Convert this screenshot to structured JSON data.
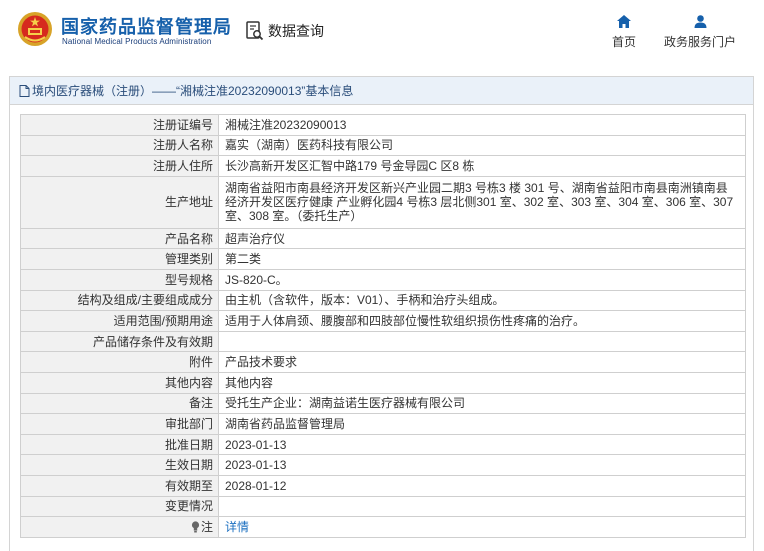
{
  "header": {
    "brand_cn": "国家药品监督管理局",
    "brand_en": "National Medical Products Administration",
    "search_label": "数据查询",
    "nav": [
      {
        "label": "首页",
        "icon": "home-icon"
      },
      {
        "label": "政务服务门户",
        "icon": "user-icon"
      }
    ]
  },
  "panel": {
    "title": "境内医疗器械（注册）——“湘械注准20232090013”基本信息"
  },
  "rows": [
    {
      "label": "注册证编号",
      "value": "湘械注准20232090013"
    },
    {
      "label": "注册人名称",
      "value": "嘉实（湖南）医药科技有限公司"
    },
    {
      "label": "注册人住所",
      "value": "长沙高新开发区汇智中路179 号金导园C 区8 栋"
    },
    {
      "label": "生产地址",
      "value": "湖南省益阳市南县经济开发区新兴产业园二期3 号栋3 楼 301 号、湖南省益阳市南县南洲镇南县经济开发区医疗健康 产业孵化园4 号栋3 层北侧301 室、302 室、303 室、304 室、306 室、307 室、308 室。（委托生产）"
    },
    {
      "label": "产品名称",
      "value": "超声治疗仪"
    },
    {
      "label": "管理类别",
      "value": "第二类"
    },
    {
      "label": "型号规格",
      "value": "JS-820-C。"
    },
    {
      "label": "结构及组成/主要组成成分",
      "value": "由主机（含软件，版本：V01）、手柄和治疗头组成。"
    },
    {
      "label": "适用范围/预期用途",
      "value": "适用于人体肩颈、腰腹部和四肢部位慢性软组织损伤性疼痛的治疗。"
    },
    {
      "label": "产品储存条件及有效期",
      "value": ""
    },
    {
      "label": "附件",
      "value": "产品技术要求"
    },
    {
      "label": "其他内容",
      "value": "其他内容"
    },
    {
      "label": "备注",
      "value": "受托生产企业：湖南益诺生医疗器械有限公司"
    },
    {
      "label": "审批部门",
      "value": "湖南省药品监督管理局"
    },
    {
      "label": "批准日期",
      "value": "2023-01-13"
    },
    {
      "label": "生效日期",
      "value": "2023-01-13"
    },
    {
      "label": "有效期至",
      "value": "2028-01-12"
    },
    {
      "label": "变更情况",
      "value": ""
    },
    {
      "label": "注",
      "value": "详情"
    }
  ],
  "colors": {
    "brand_blue": "#1660ab",
    "link_blue": "#1b6fc0",
    "panel_header_bg": "#eaf1f9",
    "label_bg": "#f1f1f1"
  }
}
